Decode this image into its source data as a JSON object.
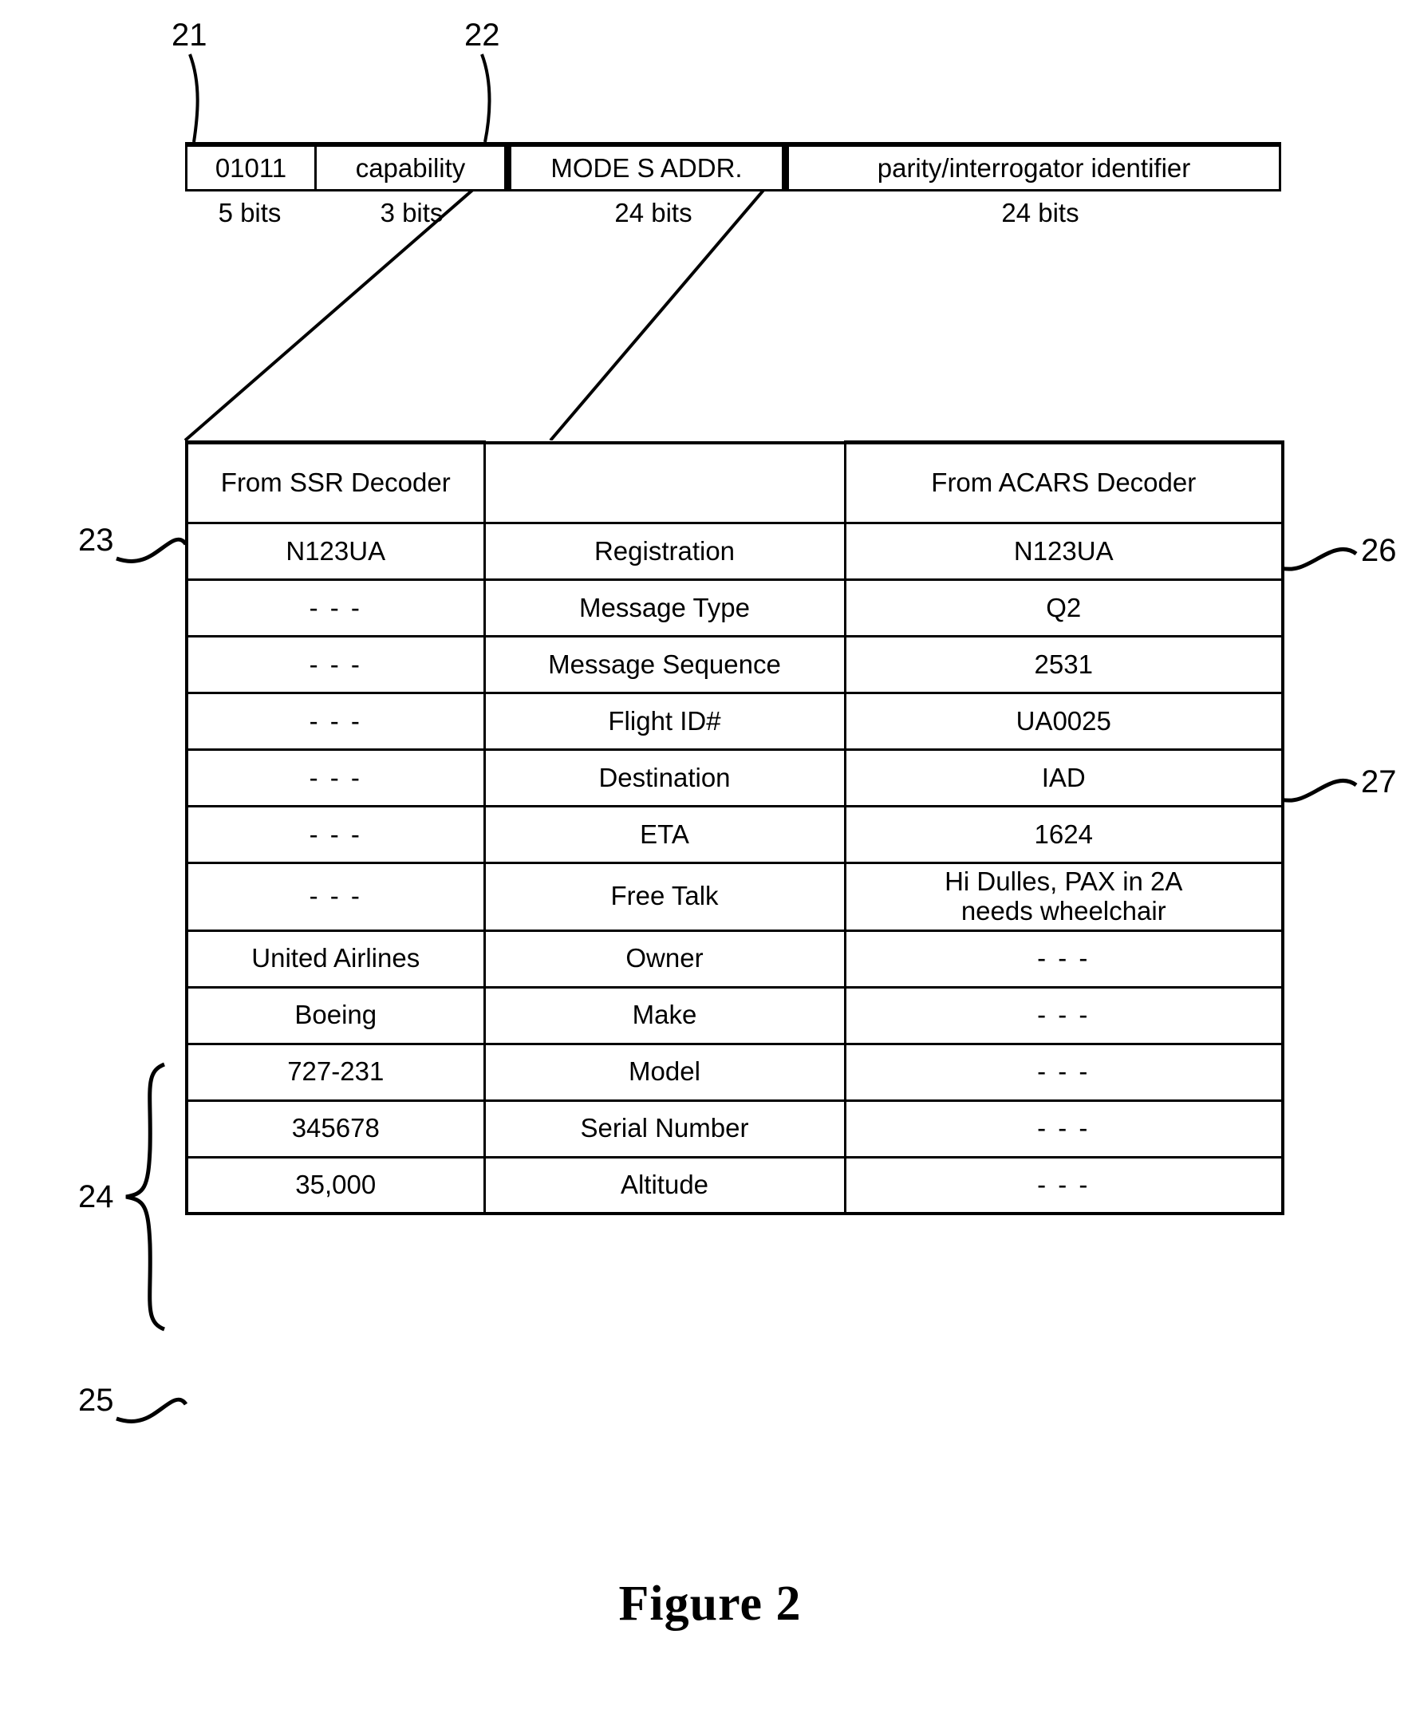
{
  "figure": {
    "caption": "Figure 2"
  },
  "message_bar": {
    "fields": [
      {
        "label": "01011",
        "bits": "5 bits"
      },
      {
        "label": "capability",
        "bits": "3 bits"
      },
      {
        "label": "MODE S ADDR.",
        "bits": "24 bits"
      },
      {
        "label": "parity/interrogator identifier",
        "bits": "24 bits"
      }
    ]
  },
  "callouts": {
    "preamble": "21",
    "mode_s_addr": "22",
    "ssr_registration": "23",
    "ssr_aircraft_details": "24",
    "ssr_altitude": "25",
    "acars_registration": "26",
    "acars_flight_id": "27"
  },
  "table": {
    "header": {
      "left": "From SSR Decoder",
      "middle": "",
      "right": "From ACARS Decoder"
    },
    "rows": [
      {
        "ssr": "N123UA",
        "field": "Registration",
        "acars": "N123UA"
      },
      {
        "ssr": "- - -",
        "field": "Message Type",
        "acars": "Q2"
      },
      {
        "ssr": "- - -",
        "field": "Message Sequence",
        "acars": "2531"
      },
      {
        "ssr": "- - -",
        "field": "Flight ID#",
        "acars": "UA0025"
      },
      {
        "ssr": "- - -",
        "field": "Destination",
        "acars": "IAD"
      },
      {
        "ssr": "- - -",
        "field": "ETA",
        "acars": "1624"
      },
      {
        "ssr": "- - -",
        "field": "Free Talk",
        "acars": "Hi Dulles, PAX in 2A\nneeds wheelchair"
      },
      {
        "ssr": "United Airlines",
        "field": "Owner",
        "acars": "- - -"
      },
      {
        "ssr": "Boeing",
        "field": "Make",
        "acars": "- - -"
      },
      {
        "ssr": "727-231",
        "field": "Model",
        "acars": "- - -"
      },
      {
        "ssr": "345678",
        "field": "Serial Number",
        "acars": "- - -"
      },
      {
        "ssr": "35,000",
        "field": "Altitude",
        "acars": "- - -"
      }
    ]
  },
  "colors": {
    "ink": "#000000",
    "paper": "#ffffff"
  }
}
